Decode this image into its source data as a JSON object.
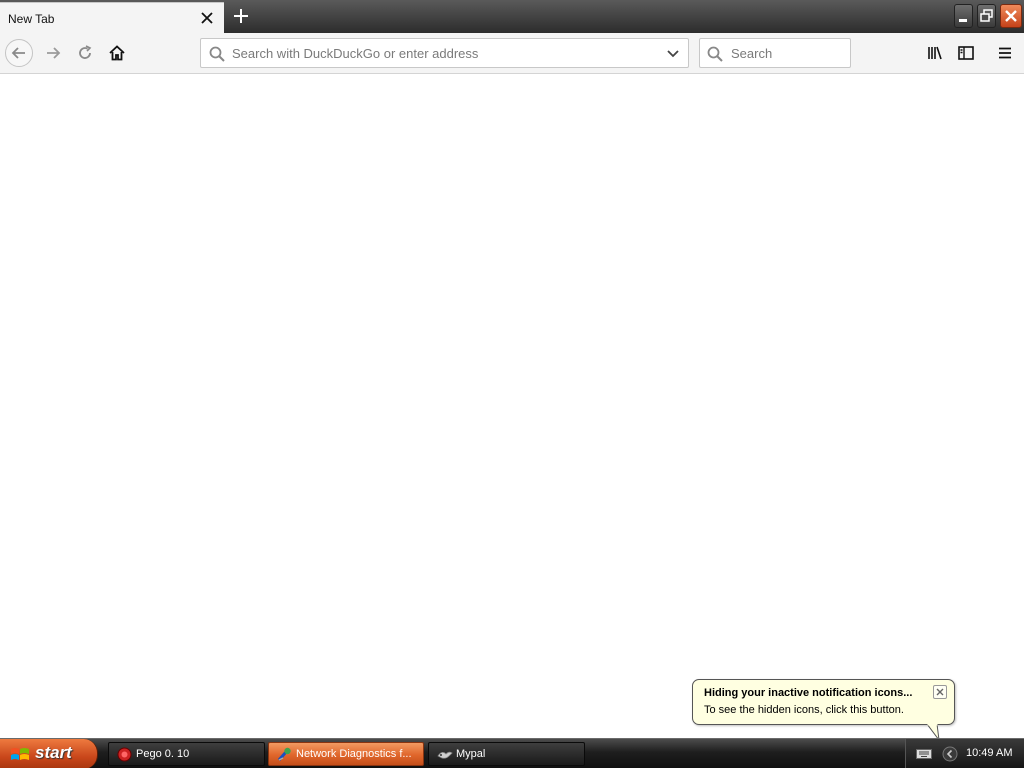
{
  "browser": {
    "tab": {
      "title": "New Tab"
    },
    "urlbar": {
      "placeholder": "Search with DuckDuckGo or enter address",
      "value": ""
    },
    "searchbar": {
      "placeholder": "Search",
      "value": ""
    }
  },
  "balloon": {
    "title": "Hiding your inactive notification icons...",
    "body": "To see the hidden icons, click this button."
  },
  "taskbar": {
    "start_label": "start",
    "tasks": [
      {
        "label": "Pego 0. 10",
        "icon": "pego-icon"
      },
      {
        "label": "Network Diagnostics f...",
        "icon": "network-diagnostics-icon",
        "active": true
      },
      {
        "label": "Mypal",
        "icon": "mypal-icon"
      }
    ],
    "clock": "10:49 AM"
  },
  "colors": {
    "start_button": "#d4551f",
    "active_task": "#e0662b",
    "balloon_bg": "#ffffe1",
    "window_close": "#d04a20"
  }
}
